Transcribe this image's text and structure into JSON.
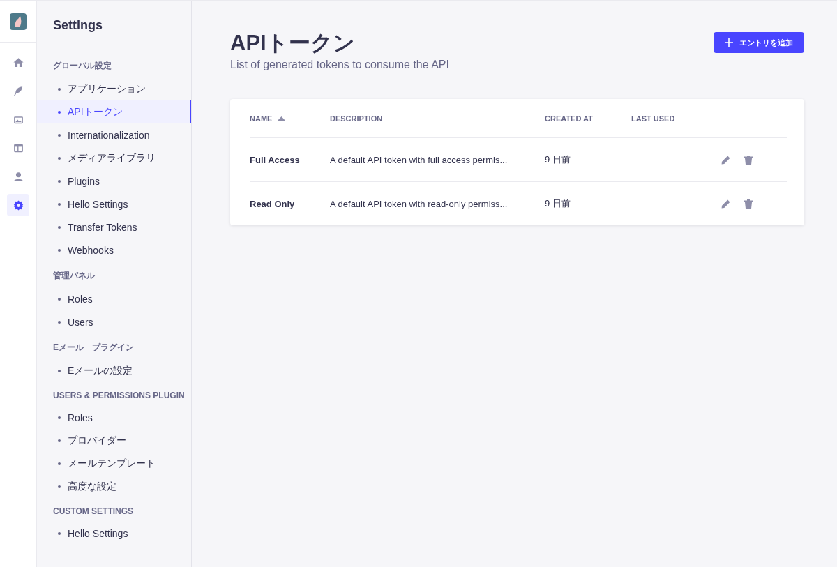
{
  "nav_rail": [
    {
      "kind": "home",
      "selected": false
    },
    {
      "kind": "feather",
      "selected": false
    },
    {
      "kind": "images",
      "selected": false
    },
    {
      "kind": "layout",
      "selected": false
    },
    {
      "kind": "user",
      "selected": false
    },
    {
      "kind": "gear",
      "selected": true
    }
  ],
  "sidebar": {
    "title": "Settings",
    "sections": [
      {
        "heading": "グローバル設定",
        "items": [
          {
            "label": "アプリケーション",
            "selected": false
          },
          {
            "label": "APIトークン",
            "selected": true
          },
          {
            "label": "Internationalization",
            "selected": false
          },
          {
            "label": "メディアライブラリ",
            "selected": false
          },
          {
            "label": "Plugins",
            "selected": false
          },
          {
            "label": "Hello Settings",
            "selected": false
          },
          {
            "label": "Transfer Tokens",
            "selected": false
          },
          {
            "label": "Webhooks",
            "selected": false
          }
        ]
      },
      {
        "heading": "管理パネル",
        "items": [
          {
            "label": "Roles",
            "selected": false
          },
          {
            "label": "Users",
            "selected": false
          }
        ]
      },
      {
        "heading": "Eメール　プラグイン",
        "items": [
          {
            "label": "Eメールの設定",
            "selected": false
          }
        ]
      },
      {
        "heading": "USERS & PERMISSIONS PLUGIN",
        "items": [
          {
            "label": "Roles",
            "selected": false
          },
          {
            "label": "プロバイダー",
            "selected": false
          },
          {
            "label": "メールテンプレート",
            "selected": false
          },
          {
            "label": "高度な設定",
            "selected": false
          }
        ]
      },
      {
        "heading": "CUSTOM SETTINGS",
        "items": [
          {
            "label": "Hello Settings",
            "selected": false
          }
        ]
      }
    ]
  },
  "header": {
    "title": "APIトークン",
    "subtitle": "List of generated tokens to consume the API",
    "add_button": "エントリを追加"
  },
  "table": {
    "columns": [
      {
        "label": "NAME",
        "sorted": true
      },
      {
        "label": "DESCRIPTION",
        "sorted": false
      },
      {
        "label": "CREATED AT",
        "sorted": false
      },
      {
        "label": "LAST USED",
        "sorted": false
      }
    ],
    "rows": [
      {
        "name": "Full Access",
        "description": "A default API token with full access permis...",
        "created_at": "9 日前"
      },
      {
        "name": "Read Only",
        "description": "A default API token with read-only permiss...",
        "created_at": "9 日前"
      }
    ]
  }
}
